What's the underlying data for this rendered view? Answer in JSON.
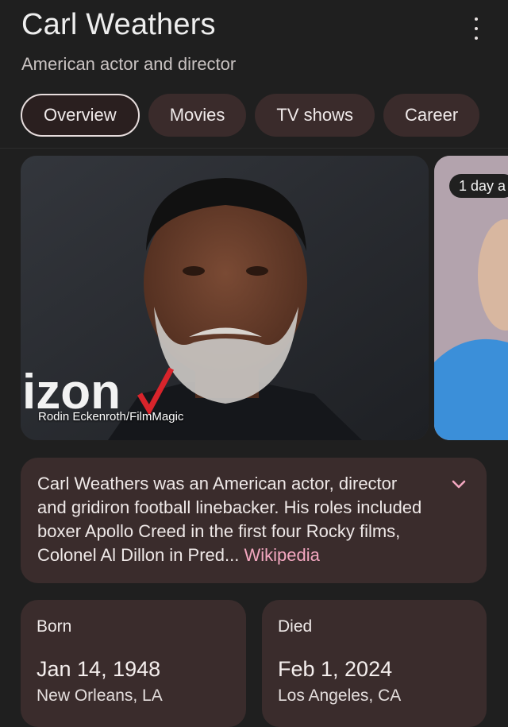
{
  "header": {
    "title": "Carl Weathers",
    "subtitle": "American actor and director"
  },
  "tabs": [
    {
      "label": "Overview",
      "active": true
    },
    {
      "label": "Movies",
      "active": false
    },
    {
      "label": "TV shows",
      "active": false
    },
    {
      "label": "Career",
      "active": false
    }
  ],
  "media": {
    "credit": "Rodin Eckenroth/FilmMagic",
    "backdrop_text": "izon",
    "next_card_time": "1 day a"
  },
  "description": {
    "text": "Carl Weathers was an American actor, director and gridiron football linebacker. His roles included boxer Apollo Creed in the first four Rocky films, Colonel Al Dillon in Pred...",
    "source_link": "Wikipedia"
  },
  "facts": {
    "born": {
      "label": "Born",
      "date": "Jan 14, 1948",
      "place": "New Orleans, LA"
    },
    "died": {
      "label": "Died",
      "date": "Feb 1, 2024",
      "place": "Los Angeles, CA"
    }
  },
  "colors": {
    "background": "#1f1f1f",
    "card": "#3a2c2c",
    "link": "#f3a7c0"
  },
  "icons": [
    "more-vert-icon",
    "chevron-down-icon"
  ]
}
